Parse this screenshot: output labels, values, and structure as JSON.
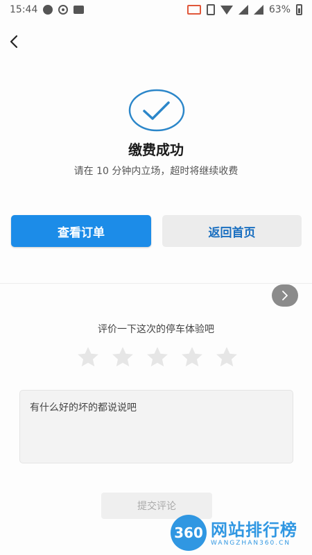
{
  "status_bar": {
    "time": "15:44",
    "battery": "63%"
  },
  "success": {
    "title": "缴费成功",
    "subtitle": "请在 10 分钟内立场，超时将继续收费"
  },
  "actions": {
    "view_order_label": "查看订单",
    "back_home_label": "返回首页"
  },
  "review": {
    "prompt": "评价一下这次的停车体验吧",
    "rating_max": 5,
    "rating_value": 0,
    "comment_placeholder": "有什么好的坏的都说说吧",
    "submit_label": "提交评论"
  },
  "watermark": {
    "logo_text": "360",
    "title": "网站排行榜",
    "subtitle": "WANGZHAN360.CN"
  },
  "colors": {
    "primary": "#1c8ce8",
    "success_ring": "#2b86c9",
    "star_empty": "#e6e6e6"
  }
}
